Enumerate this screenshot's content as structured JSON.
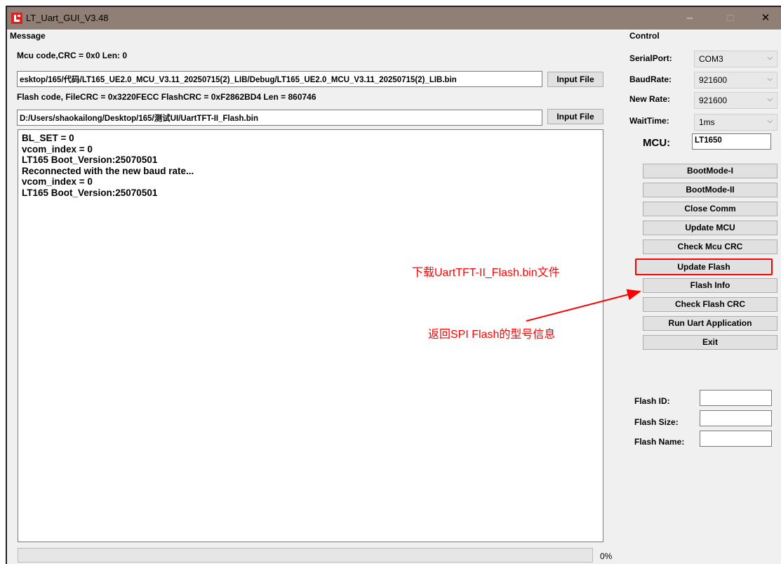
{
  "window": {
    "title": "LT_Uart_GUI_V3.48",
    "minimize": "–",
    "maximize": "□",
    "close": "✕"
  },
  "message": {
    "section_label": "Message",
    "mcu_info": "Mcu code,CRC = 0x0  Len: 0",
    "mcu_path": "esktop/165/代码/LT165_UE2.0_MCU_V3.11_20250715(2)_LIB/Debug/LT165_UE2.0_MCU_V3.11_20250715(2)_LIB.bin",
    "input_file_label": "Input File",
    "flash_info": "Flash code, FileCRC = 0x3220FECC  FlashCRC = 0xF2862BD4  Len = 860746",
    "flash_path": "D:/Users/shaokailong/Desktop/165/测试UI/UartTFT-II_Flash.bin",
    "log_lines": [
      "BL_SET = 0",
      "vcom_index = 0",
      "LT165 Boot_Version:25070501",
      "Reconnected with the new baud rate...",
      "vcom_index = 0",
      "LT165 Boot_Version:25070501"
    ],
    "progress_value": 0,
    "progress_text": "0%"
  },
  "control": {
    "section_label": "Control",
    "serial_port_label": "SerialPort:",
    "serial_port": "COM3",
    "baud_rate_label": "BaudRate:",
    "baud_rate": "921600",
    "new_rate_label": "New Rate:",
    "new_rate": "921600",
    "wait_time_label": "WaitTime:",
    "wait_time": "1ms",
    "mcu_label": "MCU:",
    "mcu_value": "LT1650",
    "buttons": [
      "BootMode-I",
      "BootMode-II",
      "Close Comm",
      "Update MCU",
      "Check Mcu CRC",
      "Update Flash",
      "Flash Info",
      "Check Flash CRC",
      "Run Uart Application",
      "Exit"
    ],
    "flash_id_label": "Flash ID:",
    "flash_id": "",
    "flash_size_label": "Flash Size:",
    "flash_size": "",
    "flash_name_label": "Flash Name:",
    "flash_name": ""
  },
  "annotations": {
    "update_flash_note": "下载UartTFT-II_Flash.bin文件",
    "flash_info_note": "返回SPI Flash的型号信息",
    "color": "#ff0000"
  },
  "icons": {
    "app": "app-icon",
    "dropdown": "chevron-down-icon"
  }
}
